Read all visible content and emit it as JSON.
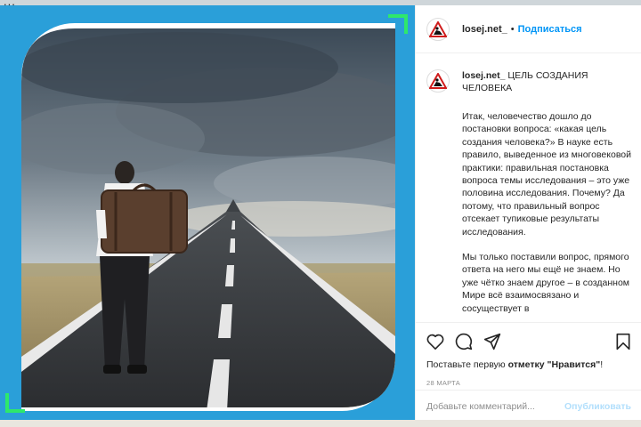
{
  "background": {
    "window_title_fragment": "..."
  },
  "post": {
    "username": "losej.net_",
    "separator": "•",
    "follow_label": "Подписаться",
    "caption_title": "ЦЕЛЬ СОЗДАНИЯ ЧЕЛОВЕКА",
    "caption_paragraph_1": "Итак, человечество дошло до постановки вопроса: «какая цель создания человека?» В науке есть правило, выведенное из многовековой практики: правильная постановка вопроса темы исследования – это уже половина исследования. Почему? Да потому, что правильный вопрос отсекает тупиковые результаты исследования.",
    "caption_paragraph_2": "Мы только поставили вопрос, прямого ответа на него мы ещё не знаем. Но уже чётко знаем другое – в созданном Мире всё взаимосвязано и сосуществует в",
    "likes_prefix": "Поставьте первую ",
    "likes_emphasis": "отметку \"Нравится\"",
    "likes_suffix": "!",
    "date": "28 МАРТА",
    "comment_placeholder": "Добавьте комментарий...",
    "post_button": "Опубликовать"
  },
  "icons": {
    "like": "heart-icon",
    "comment": "comment-icon",
    "share": "share-icon",
    "save": "bookmark-icon",
    "avatar": "warning-sign-logo"
  },
  "colors": {
    "accent_blue": "#0095f6",
    "frame_blue": "#2a9fd9",
    "corner_green": "#2ee86b"
  }
}
